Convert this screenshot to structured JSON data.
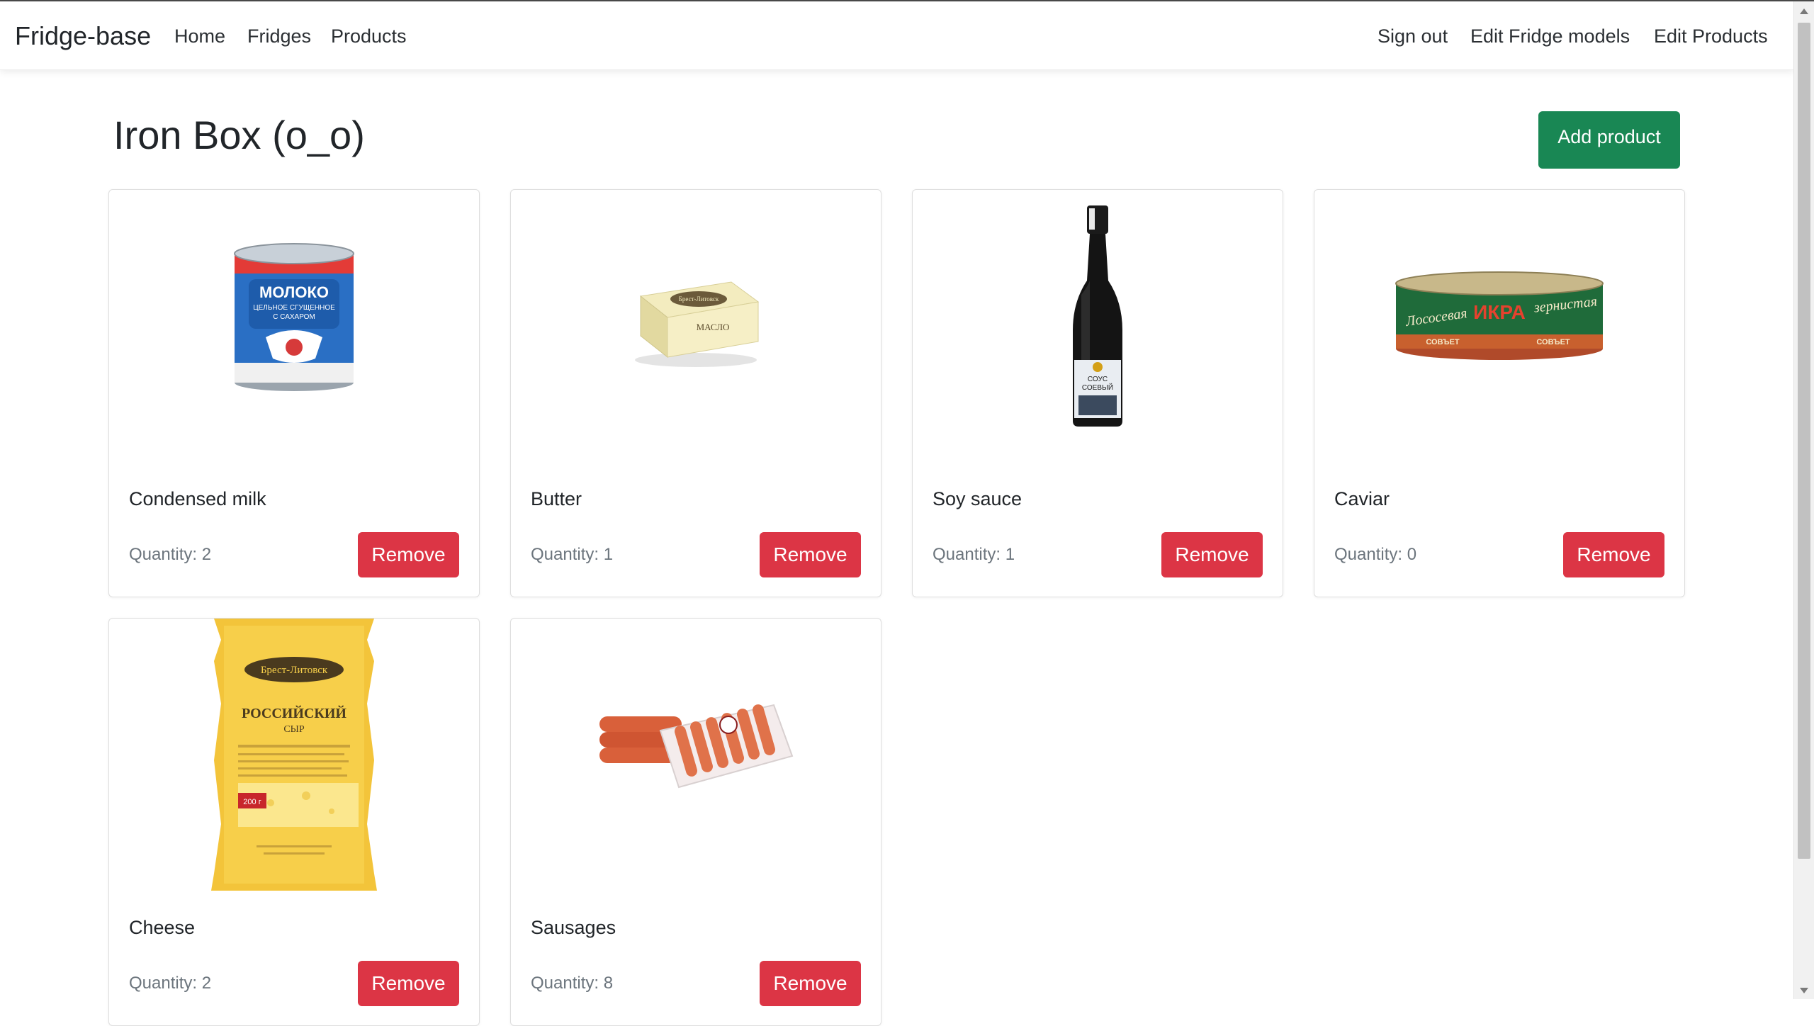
{
  "navbar": {
    "brand": "Fridge-base",
    "left_links": [
      "Home",
      "Fridges",
      "Products"
    ],
    "right_links": [
      "Sign out",
      "Edit Fridge models",
      "Edit Products"
    ]
  },
  "page": {
    "title": "Iron Box (o_o)",
    "add_button": "Add product"
  },
  "products": [
    {
      "name": "Condensed milk",
      "quantity": "Quantity: 2",
      "remove": "Remove",
      "image_icon": "condensed-milk-can-icon",
      "image_text": [
        "МОЛОКО",
        "ЦЕЛЬНОЕ СГУЩЕННОЕ",
        "С САХАРОМ"
      ]
    },
    {
      "name": "Butter",
      "quantity": "Quantity: 1",
      "remove": "Remove",
      "image_icon": "butter-package-icon",
      "image_text": [
        "Брест-Литовск",
        "МАСЛО"
      ]
    },
    {
      "name": "Soy sauce",
      "quantity": "Quantity: 1",
      "remove": "Remove",
      "image_icon": "soy-sauce-bottle-icon",
      "image_text": [
        "СОУС",
        "СОЕВЫЙ"
      ]
    },
    {
      "name": "Caviar",
      "quantity": "Quantity: 0",
      "remove": "Remove",
      "image_icon": "caviar-tin-icon",
      "image_text": [
        "Лососевая",
        "ИКРА",
        "зернистая",
        "СОВЪЕТ",
        "СОВЪЕТ"
      ]
    },
    {
      "name": "Cheese",
      "quantity": "Quantity: 2",
      "remove": "Remove",
      "image_icon": "cheese-package-icon",
      "image_text": [
        "Брест-Литовск",
        "РОССИЙСКИЙ",
        "СЫР",
        "200 г"
      ]
    },
    {
      "name": "Sausages",
      "quantity": "Quantity: 8",
      "remove": "Remove",
      "image_icon": "sausages-pack-icon",
      "image_text": []
    }
  ],
  "colors": {
    "primary_success": "#198754",
    "danger": "#dc3545",
    "muted_text": "#6c757d"
  }
}
